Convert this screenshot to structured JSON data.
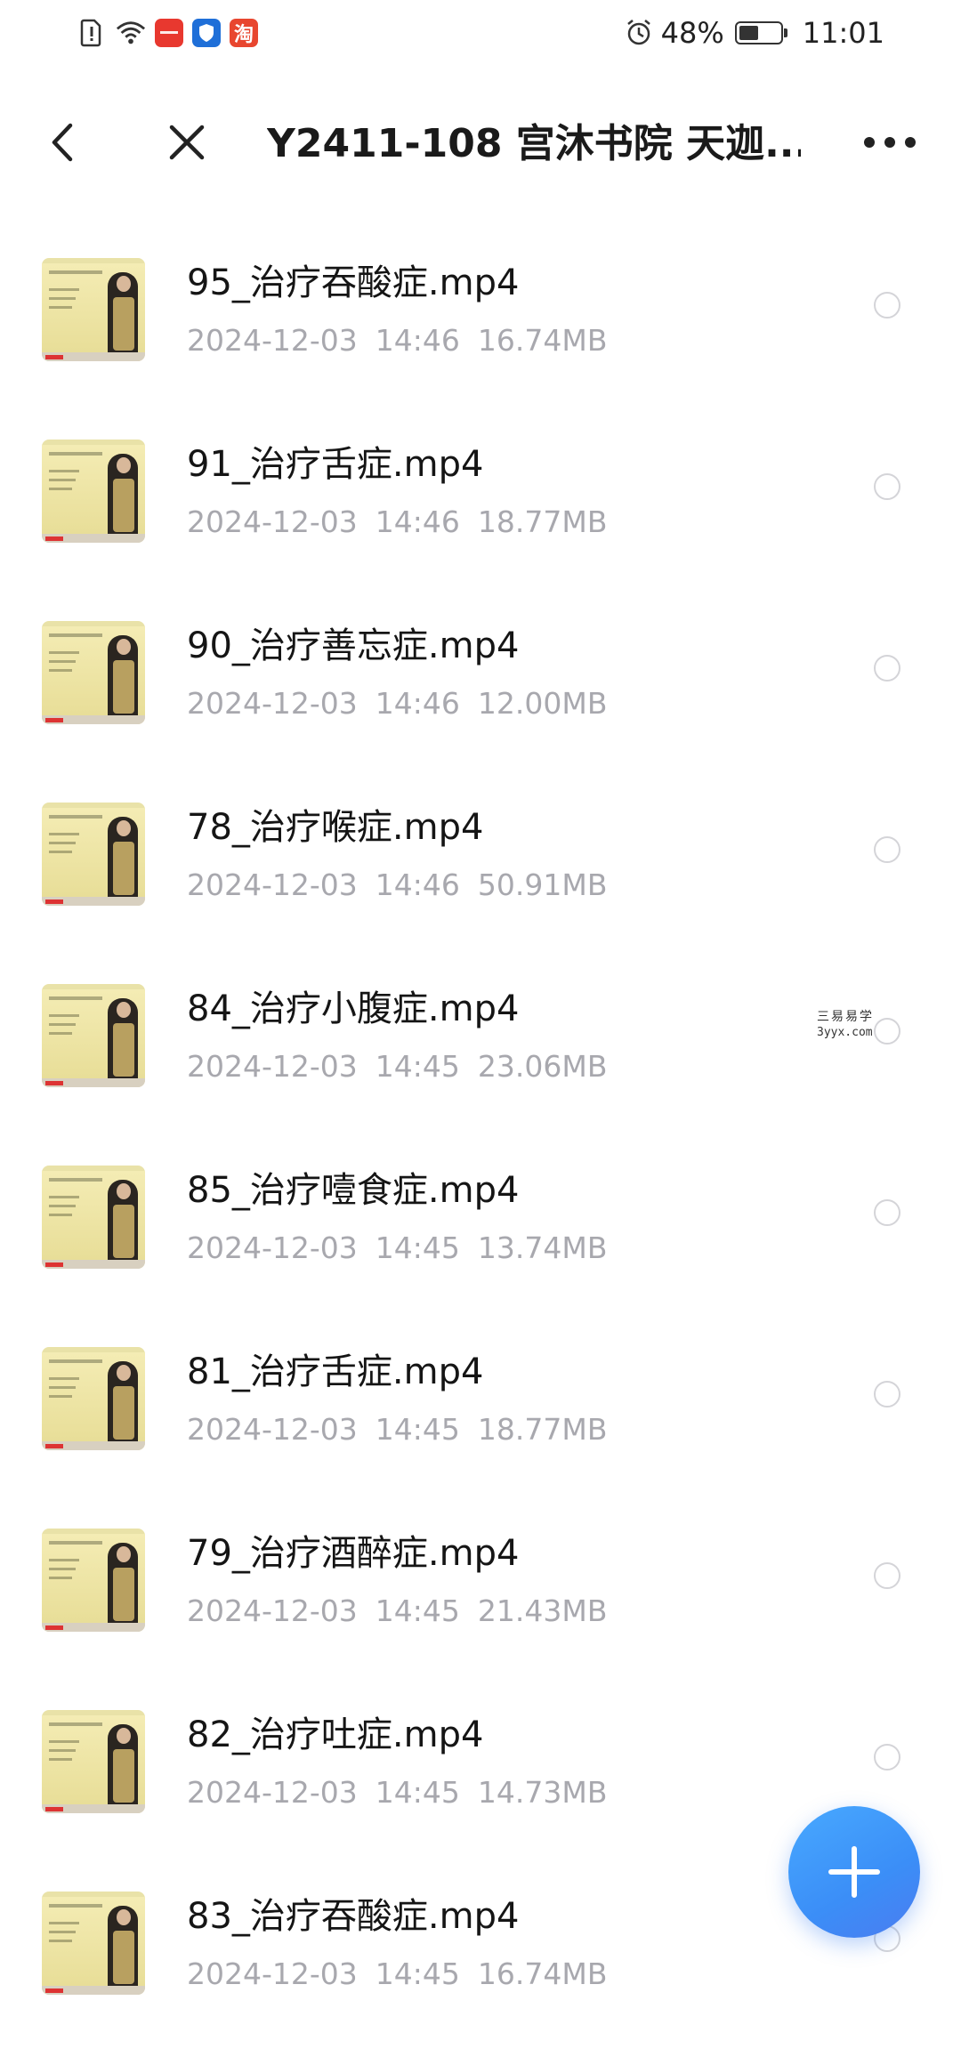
{
  "status_bar": {
    "left_icons": [
      "sim-alert-icon",
      "wifi-icon",
      "app-badge-icon",
      "shield-app-icon",
      "taobao-app-icon"
    ],
    "taobao_glyph": "淘",
    "alarm_icon": "alarm-clock-icon",
    "battery_percent": "48%",
    "battery_level": 0.48,
    "time": "11:01"
  },
  "header": {
    "title": "Y2411-108 宫沐书院 天迦...",
    "back_icon": "chevron-left-icon",
    "close_icon": "close-icon",
    "more_icon": "more-horizontal-icon"
  },
  "files": [
    {
      "name": "95_治疗吞酸症.mp4",
      "date": "2024-12-03",
      "time": "14:46",
      "size": "16.74MB"
    },
    {
      "name": "91_治疗舌症.mp4",
      "date": "2024-12-03",
      "time": "14:46",
      "size": "18.77MB"
    },
    {
      "name": "90_治疗善忘症.mp4",
      "date": "2024-12-03",
      "time": "14:46",
      "size": "12.00MB"
    },
    {
      "name": "78_治疗喉症.mp4",
      "date": "2024-12-03",
      "time": "14:46",
      "size": "50.91MB"
    },
    {
      "name": "84_治疗小腹症.mp4",
      "date": "2024-12-03",
      "time": "14:45",
      "size": "23.06MB"
    },
    {
      "name": "85_治疗噎食症.mp4",
      "date": "2024-12-03",
      "time": "14:45",
      "size": "13.74MB"
    },
    {
      "name": "81_治疗舌症.mp4",
      "date": "2024-12-03",
      "time": "14:45",
      "size": "18.77MB"
    },
    {
      "name": "79_治疗酒醉症.mp4",
      "date": "2024-12-03",
      "time": "14:45",
      "size": "21.43MB"
    },
    {
      "name": "82_治疗吐症.mp4",
      "date": "2024-12-03",
      "time": "14:45",
      "size": "14.73MB"
    },
    {
      "name": "83_治疗吞酸症.mp4",
      "date": "2024-12-03",
      "time": "14:45",
      "size": "16.74MB"
    }
  ],
  "watermark": {
    "text": "三易易学",
    "url": "3yyx.com"
  },
  "fab": {
    "icon": "plus-icon",
    "color": "#3b8ef7"
  },
  "colors": {
    "meta_text": "#a8a8ae",
    "title_text": "#1a1a1a",
    "radio_border": "#d4d4d8"
  }
}
